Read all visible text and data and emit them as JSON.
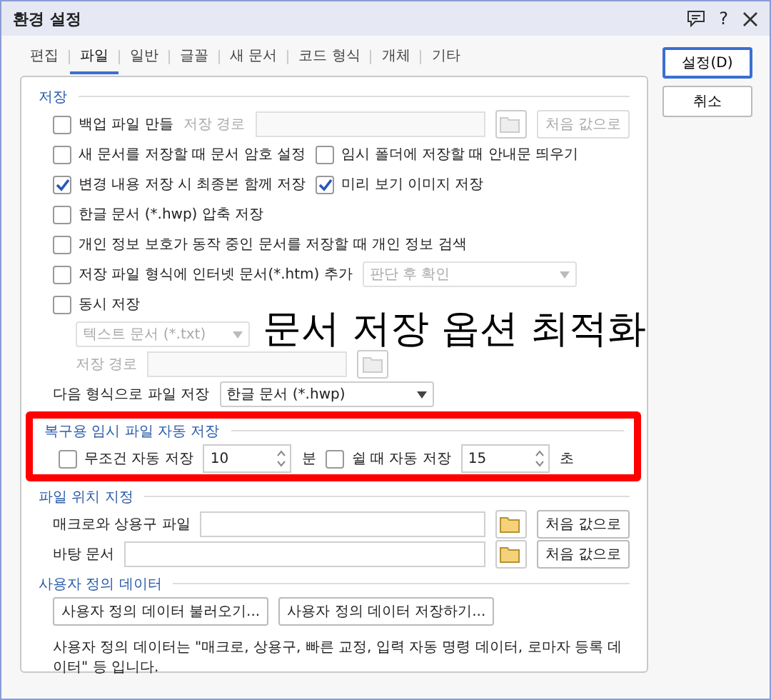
{
  "window": {
    "title": "환경 설정",
    "help": "?"
  },
  "tabs": [
    {
      "label": "편집",
      "selected": false
    },
    {
      "label": "파일",
      "selected": true
    },
    {
      "label": "일반",
      "selected": false
    },
    {
      "label": "글꼴",
      "selected": false
    },
    {
      "label": "새 문서",
      "selected": false
    },
    {
      "label": "코드 형식",
      "selected": false
    },
    {
      "label": "개체",
      "selected": false
    },
    {
      "label": "기타",
      "selected": false
    }
  ],
  "buttons": [
    {
      "label": "설정(D)",
      "kind": "default"
    },
    {
      "label": "취소",
      "kind": "normal"
    }
  ],
  "sections": [
    {
      "title": "저장",
      "highlighted": false,
      "rows": [
        {
          "items": [
            {
              "kind": "checkbox",
              "label": "백업 파일 만들",
              "checked": false
            },
            {
              "kind": "label",
              "text": "저장 경로",
              "disabled": true
            },
            {
              "kind": "field",
              "disabled": true
            },
            {
              "kind": "folder",
              "disabled": true
            },
            {
              "kind": "button",
              "label": "처음 값으로",
              "disabled": true
            }
          ]
        },
        {
          "items": [
            {
              "kind": "checkbox",
              "label": "새 문서를 저장할 때 문서 암호 설정",
              "checked": false
            },
            {
              "kind": "checkbox",
              "label": "임시 폴더에 저장할 때 안내문 띄우기",
              "checked": false
            }
          ]
        },
        {
          "items": [
            {
              "kind": "checkbox",
              "label": "변경 내용 저장 시 최종본 함께 저장",
              "checked": true
            },
            {
              "kind": "checkbox",
              "label": "미리 보기 이미지 저장",
              "checked": true
            }
          ]
        },
        {
          "items": [
            {
              "kind": "checkbox",
              "label": "한글 문서 (*.hwp) 압축 저장",
              "checked": false
            }
          ]
        },
        {
          "items": [
            {
              "kind": "checkbox",
              "label": "개인 정보 보호가 동작 중인 문서를 저장할 때 개인 정보 검색",
              "checked": false
            }
          ]
        },
        {
          "items": [
            {
              "kind": "checkbox",
              "label": "저장 파일 형식에 인터넷 문서(*.htm) 추가",
              "checked": false
            },
            {
              "kind": "dropdown",
              "value": "판단 후 확인",
              "disabled": true
            }
          ]
        },
        {
          "items": [
            {
              "kind": "checkbox",
              "label": "동시 저장",
              "checked": false
            }
          ],
          "children": [
            {
              "items": [
                {
                  "kind": "dropdown",
                  "value": "텍스트 문서 (*.txt)",
                  "disabled": true
                }
              ]
            },
            {
              "items": [
                {
                  "kind": "label",
                  "text": "저장 경로",
                  "disabled": true
                },
                {
                  "kind": "field",
                  "disabled": true
                },
                {
                  "kind": "folder",
                  "disabled": true
                }
              ]
            }
          ]
        },
        {
          "items": [
            {
              "kind": "label",
              "text": "다음 형식으로 파일 저장",
              "disabled": false
            },
            {
              "kind": "dropdown",
              "value": "한글 문서 (*.hwp)",
              "disabled": false
            }
          ]
        }
      ]
    },
    {
      "title": "복구용 임시 파일 자동 저장",
      "highlighted": true,
      "rows": [
        {
          "items": [
            {
              "kind": "checkbox",
              "label": "무조건 자동 저장",
              "checked": false
            },
            {
              "kind": "spin",
              "value": "10"
            },
            {
              "kind": "label",
              "text": "분",
              "disabled": false
            },
            {
              "kind": "checkbox",
              "label": "쉴 때 자동 저장",
              "checked": false
            },
            {
              "kind": "spin",
              "value": "15"
            },
            {
              "kind": "label",
              "text": "초",
              "disabled": false
            }
          ]
        }
      ]
    },
    {
      "title": "파일 위치 지정",
      "highlighted": false,
      "rows": [
        {
          "items": [
            {
              "kind": "label",
              "text": "매크로와 상용구 파일",
              "disabled": false
            },
            {
              "kind": "field",
              "disabled": false
            },
            {
              "kind": "folder",
              "disabled": false
            },
            {
              "kind": "button",
              "label": "처음 값으로",
              "disabled": false
            }
          ]
        },
        {
          "items": [
            {
              "kind": "label",
              "text": "바탕 문서",
              "disabled": false
            },
            {
              "kind": "field",
              "disabled": false
            },
            {
              "kind": "folder",
              "disabled": false
            },
            {
              "kind": "button",
              "label": "처음 값으로",
              "disabled": false
            }
          ]
        }
      ]
    },
    {
      "title": "사용자 정의 데이터",
      "highlighted": false,
      "rows": [
        {
          "items": [
            {
              "kind": "button",
              "label": "사용자 정의 데이터 불러오기...",
              "disabled": false
            },
            {
              "kind": "button",
              "label": "사용자 정의 데이터 저장하기...",
              "disabled": false
            }
          ]
        },
        {
          "items": [
            {
              "kind": "note",
              "text": "사용자 정의 데이터는 \"매크로, 상용구, 빠른 교정, 입력 자동 명령 데이터, 로마자 등록 데이터\" 등 입니다."
            }
          ]
        }
      ]
    }
  ],
  "overlay_caption": "문서 저장 옵션 최적화"
}
